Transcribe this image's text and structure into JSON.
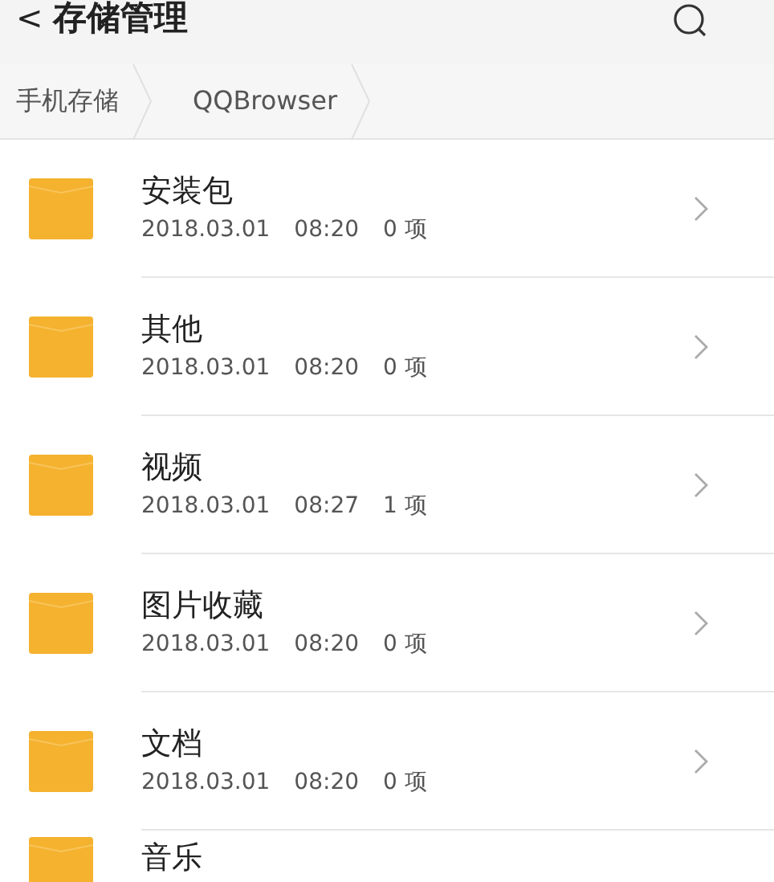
{
  "header": {
    "back": "<",
    "title": "存储管理"
  },
  "breadcrumb": [
    {
      "label": "手机存储"
    },
    {
      "label": "QQBrowser"
    }
  ],
  "folders": [
    {
      "name": "安装包",
      "date": "2018.03.01",
      "time": "08:20",
      "count": "0 项"
    },
    {
      "name": "其他",
      "date": "2018.03.01",
      "time": "08:20",
      "count": "0 项"
    },
    {
      "name": "视频",
      "date": "2018.03.01",
      "time": "08:27",
      "count": "1 项"
    },
    {
      "name": "图片收藏",
      "date": "2018.03.01",
      "time": "08:20",
      "count": "0 项"
    },
    {
      "name": "文档",
      "date": "2018.03.01",
      "time": "08:20",
      "count": "0 项"
    },
    {
      "name": "音乐"
    }
  ]
}
